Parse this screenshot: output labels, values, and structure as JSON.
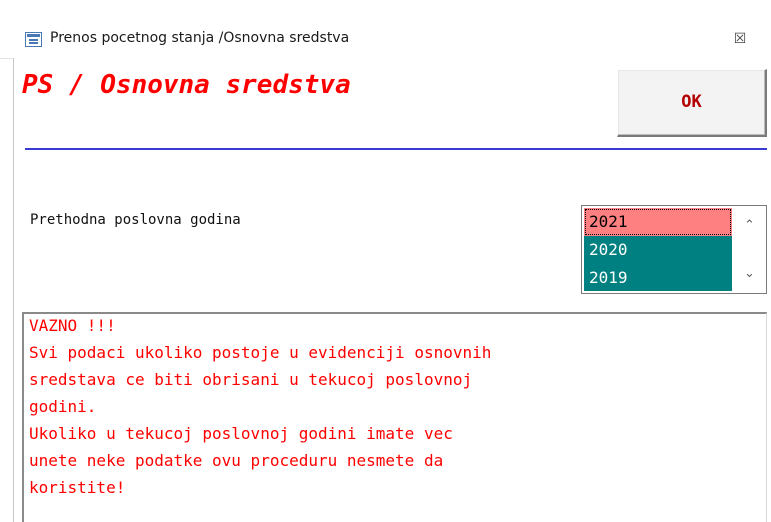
{
  "window": {
    "title": "Prenos pocetnog stanja /Osnovna sredstva",
    "close_glyph": "☒"
  },
  "form": {
    "heading": "PS / Osnovna sredstva",
    "ok_label": "OK",
    "year_label": "Prethodna poslovna godina"
  },
  "year_list": {
    "items": [
      "2021",
      "2020",
      "2019"
    ],
    "selected": "2021",
    "selected_color": "#ff8080",
    "background_color": "#008080",
    "scroll_up_glyph": "⌃",
    "scroll_down_glyph": "⌄"
  },
  "warning": {
    "lines": [
      "VAZNO !!!",
      "Svi podaci ukoliko postoje u evidenciji osnovnih",
      "sredstava ce biti obrisani u tekucoj poslovnoj",
      "godini.",
      "Ukoliko u tekucoj poslovnoj godini imate vec",
      "unete neke podatke ovu proceduru nesmete da",
      "koristite!"
    ],
    "text_color": "#ff0000"
  },
  "colors": {
    "separator": "#3a3ad6",
    "heading": "#ff0000",
    "ok_text": "#b40000"
  }
}
